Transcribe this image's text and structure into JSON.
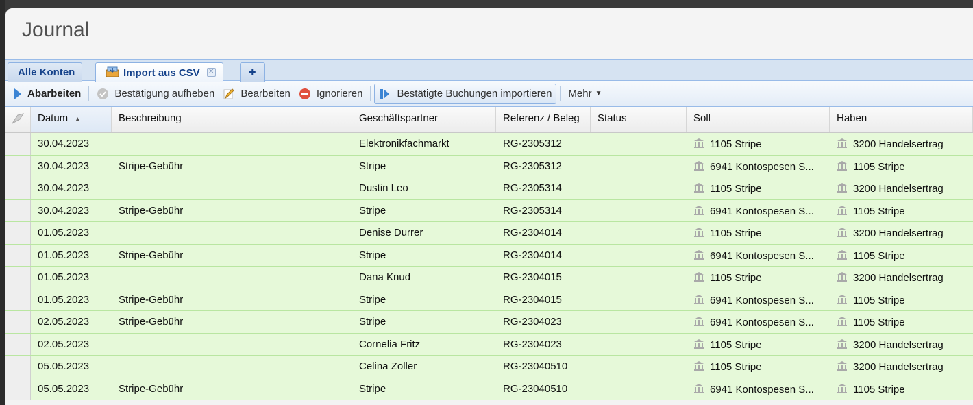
{
  "window": {
    "title": "Journal"
  },
  "tabs": [
    {
      "label": "Alle Konten"
    },
    {
      "label": "Import aus CSV"
    },
    {
      "label": "+"
    }
  ],
  "toolbar": {
    "process_label": "Abarbeiten",
    "unconfirm_label": "Bestätigung aufheben",
    "edit_label": "Bearbeiten",
    "ignore_label": "Ignorieren",
    "import_label": "Bestätigte Buchungen importieren",
    "more_label": "Mehr"
  },
  "grid": {
    "columns": [
      "Datum",
      "Beschreibung",
      "Geschäftspartner",
      "Referenz / Beleg",
      "Status",
      "Soll",
      "Haben"
    ],
    "sort_indicator": "▲",
    "row_color": "#e6f9d9",
    "rows": [
      {
        "datum": "30.04.2023",
        "beschreibung": "",
        "partner": "Elektronikfachmarkt",
        "referenz": "RG-2305312",
        "status": "",
        "soll": "1105 Stripe",
        "haben": "3200 Handelsertrag"
      },
      {
        "datum": "30.04.2023",
        "beschreibung": "Stripe-Gebühr",
        "partner": "Stripe",
        "referenz": "RG-2305312",
        "status": "",
        "soll": "6941 Kontospesen S...",
        "haben": "1105 Stripe"
      },
      {
        "datum": "30.04.2023",
        "beschreibung": "",
        "partner": "Dustin Leo",
        "referenz": "RG-2305314",
        "status": "",
        "soll": "1105 Stripe",
        "haben": "3200 Handelsertrag"
      },
      {
        "datum": "30.04.2023",
        "beschreibung": "Stripe-Gebühr",
        "partner": "Stripe",
        "referenz": "RG-2305314",
        "status": "",
        "soll": "6941 Kontospesen S...",
        "haben": "1105 Stripe"
      },
      {
        "datum": "01.05.2023",
        "beschreibung": "",
        "partner": "Denise Durrer",
        "referenz": "RG-2304014",
        "status": "",
        "soll": "1105 Stripe",
        "haben": "3200 Handelsertrag"
      },
      {
        "datum": "01.05.2023",
        "beschreibung": "Stripe-Gebühr",
        "partner": "Stripe",
        "referenz": "RG-2304014",
        "status": "",
        "soll": "6941 Kontospesen S...",
        "haben": "1105 Stripe"
      },
      {
        "datum": "01.05.2023",
        "beschreibung": "",
        "partner": "Dana Knud",
        "referenz": "RG-2304015",
        "status": "",
        "soll": "1105 Stripe",
        "haben": "3200 Handelsertrag"
      },
      {
        "datum": "01.05.2023",
        "beschreibung": "Stripe-Gebühr",
        "partner": "Stripe",
        "referenz": "RG-2304015",
        "status": "",
        "soll": "6941 Kontospesen S...",
        "haben": "1105 Stripe"
      },
      {
        "datum": "02.05.2023",
        "beschreibung": "Stripe-Gebühr",
        "partner": "Stripe",
        "referenz": "RG-2304023",
        "status": "",
        "soll": "6941 Kontospesen S...",
        "haben": "1105 Stripe"
      },
      {
        "datum": "02.05.2023",
        "beschreibung": "",
        "partner": "Cornelia Fritz",
        "referenz": "RG-2304023",
        "status": "",
        "soll": "1105 Stripe",
        "haben": "3200 Handelsertrag"
      },
      {
        "datum": "05.05.2023",
        "beschreibung": "",
        "partner": "Celina Zoller",
        "referenz": "RG-23040510",
        "status": "",
        "soll": "1105 Stripe",
        "haben": "3200 Handelsertrag"
      },
      {
        "datum": "05.05.2023",
        "beschreibung": "Stripe-Gebühr",
        "partner": "Stripe",
        "referenz": "RG-23040510",
        "status": "",
        "soll": "6941 Kontospesen S...",
        "haben": "1105 Stripe"
      }
    ]
  }
}
